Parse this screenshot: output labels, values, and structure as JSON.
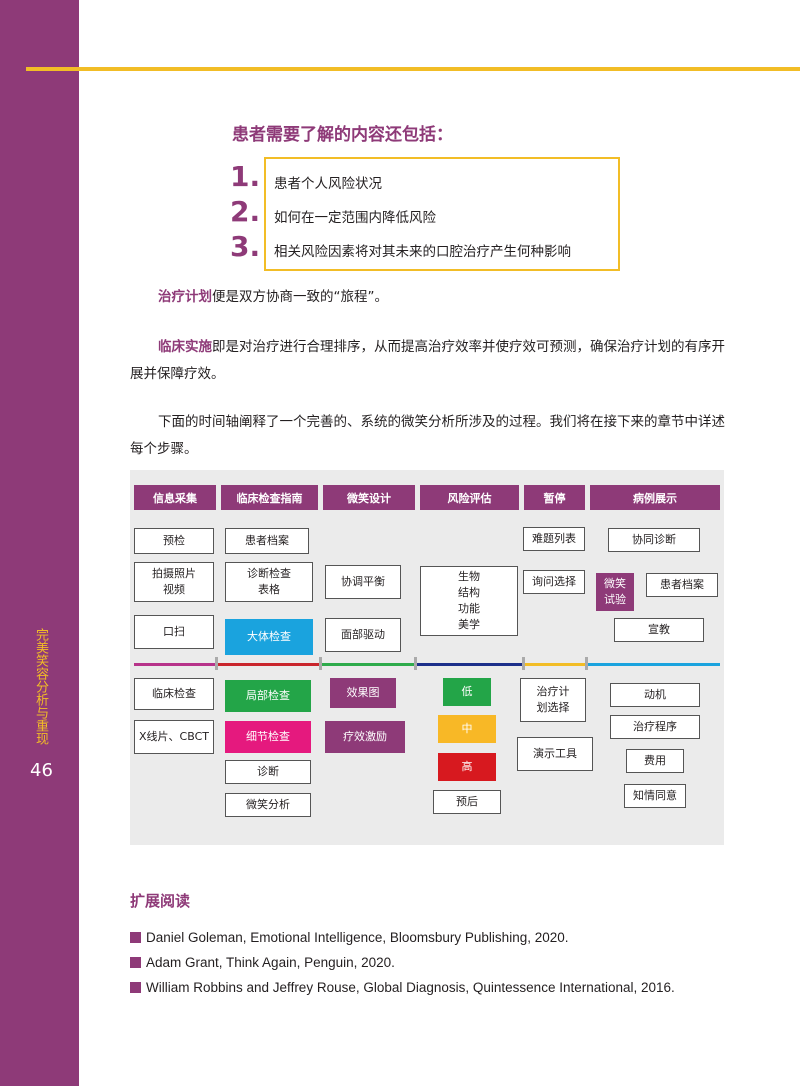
{
  "sidebar": {
    "title": "完美笑容分析与重现",
    "page_number": "46"
  },
  "section": {
    "title": "患者需要了解的内容还包括：",
    "items": [
      {
        "number": "1.",
        "text": "患者个人风险状况"
      },
      {
        "number": "2.",
        "text": "如何在一定范围内降低风险"
      },
      {
        "number": "3.",
        "text": "相关风险因素将对其未来的口腔治疗产生何种影响"
      }
    ]
  },
  "paragraphs": {
    "p1_highlight": "治疗计划",
    "p1_text": "便是双方协商一致的“旅程”。",
    "p2_highlight": "临床实施",
    "p2_text": "即是对治疗进行合理排序，从而提高治疗效率并使疗效可预测，确保治疗计划的有序开展并保障疗效。",
    "p3_text": "下面的时间轴阐释了一个完善的、系统的微笑分析所涉及的过程。我们将在接下来的章节中详述每个步骤。"
  },
  "diagram": {
    "headers": [
      "信息采集",
      "临床检查指南",
      "微笑设计",
      "风险评估",
      "暂停",
      "病例展示"
    ],
    "col1": [
      "预检",
      "拍摄照片\n视频",
      "口扫",
      "临床检查",
      "X线片、CBCT"
    ],
    "col2": [
      "患者档案",
      "诊断检查\n表格",
      "大体检查",
      "局部检查",
      "细节检查",
      "诊断",
      "微笑分析"
    ],
    "col3": [
      "协调平衡",
      "面部驱动",
      "效果图",
      "疗效激励"
    ],
    "col4": [
      "生物\n结构\n功能\n美学",
      "低",
      "中",
      "高",
      "预后"
    ],
    "col5": [
      "难题列表",
      "询问选择",
      "治疗计\n划选择",
      "演示工具"
    ],
    "col6": [
      "协同诊断",
      "微笑\n试验",
      "患者档案",
      "宣教",
      "动机",
      "治疗程序",
      "费用",
      "知情同意"
    ],
    "timeline_colors": [
      "#b7338a",
      "#c9252c",
      "#2eab4b",
      "#1c2f8a",
      "#f2bd26",
      "#1aa3de"
    ]
  },
  "further_reading": {
    "title": "扩展阅读",
    "refs": [
      "Daniel Goleman, Emotional Intelligence, Bloomsbury Publishing, 2020.",
      "Adam Grant, Think Again, Penguin, 2020.",
      "William Robbins and Jeffrey Rouse, Global Diagnosis, Quintessence International, 2016."
    ]
  },
  "colors": {
    "brand_purple": "#8e3a78",
    "accent_yellow": "#f2bd26"
  }
}
